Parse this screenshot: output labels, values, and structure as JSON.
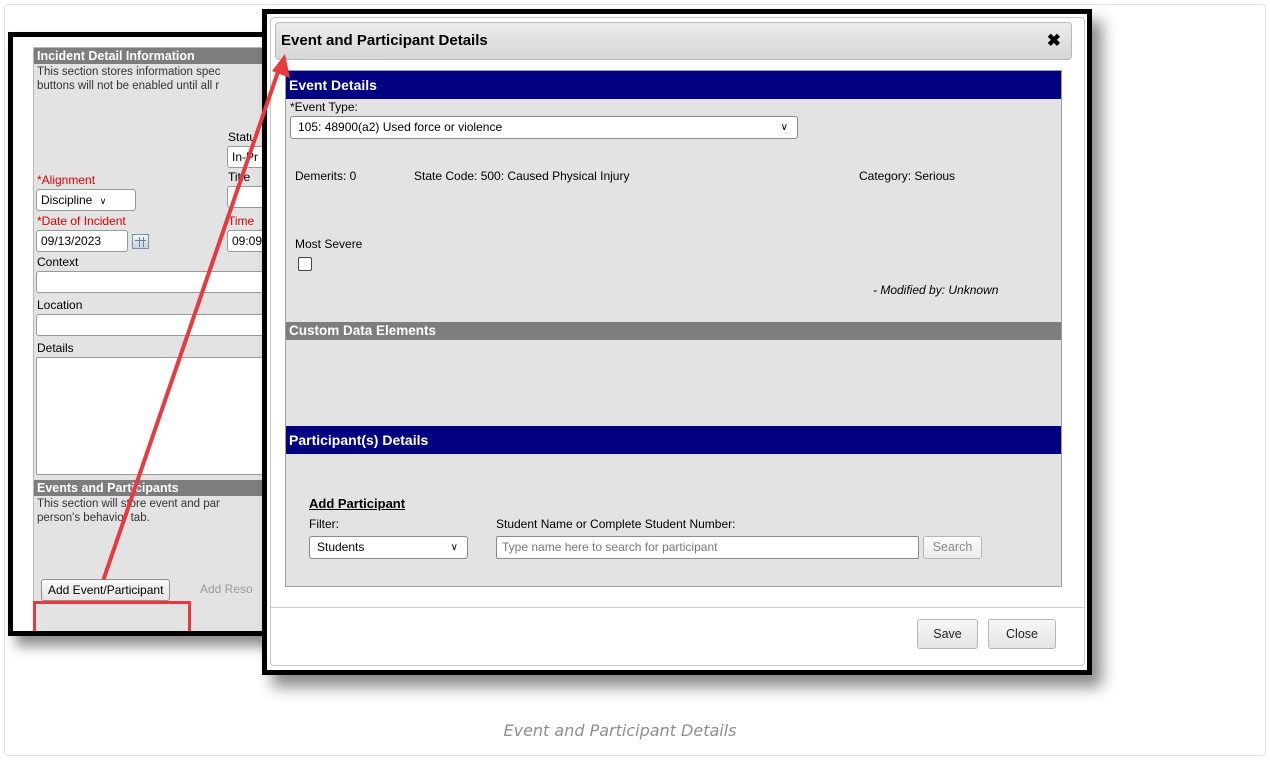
{
  "background_screen": {
    "incident_section_title": "Incident Detail Information",
    "incident_desc_line1": "This section stores information spec",
    "incident_desc_line2": "buttons will not be enabled until all r",
    "status_label": "Statu",
    "status_value": "In-Pr",
    "title_label": "Title",
    "alignment_label": "*Alignment",
    "alignment_value": "Discipline",
    "date_label": "*Date of Incident",
    "date_value": "09/13/2023",
    "time_label": "Time",
    "time_value": "09:09",
    "context_label": "Context",
    "location_label": "Location",
    "details_label": "Details",
    "events_section_title": "Events and Participants",
    "events_desc_line1": "This section will store event and par",
    "events_desc_line2": "person's behavior tab.",
    "add_event_button": "Add Event/Participant",
    "add_resolution_button": "Add Reso"
  },
  "modal": {
    "title": "Event and Participant Details",
    "close_glyph": "✖",
    "event_details": {
      "header": "Event Details",
      "event_type_label": "*Event Type:",
      "event_type_value": "105: 48900(a2) Used force or violence",
      "demerits": "Demerits: 0",
      "state_code": "State Code: 500: Caused Physical Injury",
      "category": "Category: Serious",
      "most_severe_label": "Most Severe",
      "most_severe_checked": false,
      "modified_by": "- Modified by: Unknown"
    },
    "custom_data_header": "Custom Data Elements",
    "participant_details": {
      "header": "Participant(s) Details",
      "add_participant_title": "Add Participant",
      "filter_label": "Filter:",
      "filter_value": "Students",
      "student_search_label": "Student Name or Complete Student Number:",
      "search_placeholder": "Type name here to search for participant",
      "search_button": "Search"
    },
    "save_button": "Save",
    "close_button": "Close"
  },
  "caption": "Event and Participant Details",
  "annotation_color": "#e8393f"
}
